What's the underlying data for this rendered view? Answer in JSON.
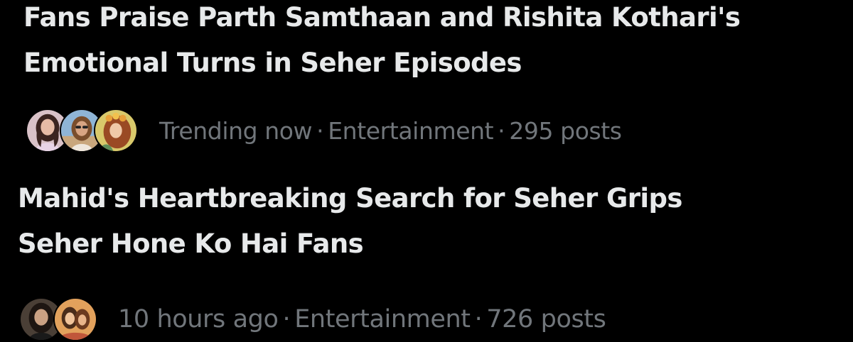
{
  "stories": [
    {
      "title_line1": "Fans Praise Parth Samthaan and Rishita Kothari's",
      "title_line2": "Emotional Turns in Seher Episodes",
      "status": "Trending now",
      "separator": "·",
      "category": "Entertainment",
      "posts": "295 posts",
      "avatars": [
        "avatar-woman-long-hair",
        "avatar-woman-sunglasses",
        "avatar-woman-flower-crown"
      ]
    },
    {
      "title_line1": "Mahid's Heartbreaking Search for Seher Grips",
      "title_line2": "Seher Hone Ko Hai Fans",
      "status": "10 hours ago",
      "separator": "·",
      "category": "Entertainment",
      "posts": "726 posts",
      "avatars": [
        "avatar-woman-dark-hair",
        "avatar-couple-illustration"
      ]
    }
  ],
  "colors": {
    "background": "#000000",
    "headline": "#e7e9ea",
    "meta": "#71767b"
  }
}
